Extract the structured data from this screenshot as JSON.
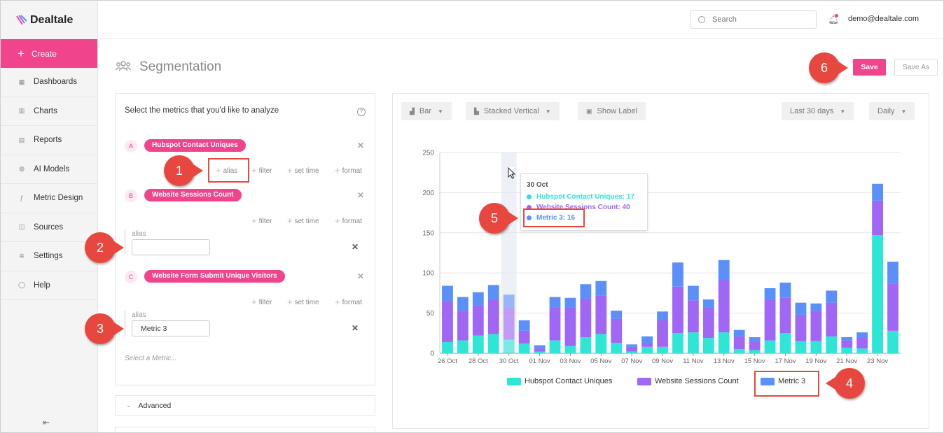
{
  "brand": "Dealtale",
  "sidebar": {
    "create_label": "Create",
    "items": [
      {
        "label": "Dashboards",
        "icon": "grid-icon"
      },
      {
        "label": "Charts",
        "icon": "bar-chart-icon"
      },
      {
        "label": "Reports",
        "icon": "document-icon"
      },
      {
        "label": "AI Models",
        "icon": "ai-icon"
      },
      {
        "label": "Metric Design",
        "icon": "function-icon"
      },
      {
        "label": "Sources",
        "icon": "database-icon"
      },
      {
        "label": "Settings",
        "icon": "gear-icon"
      },
      {
        "label": "Help",
        "icon": "help-icon"
      }
    ]
  },
  "topbar": {
    "search_placeholder": "Search",
    "user_email": "demo@dealtale.com"
  },
  "page": {
    "title": "Segmentation",
    "save": "Save",
    "save_as": "Save As"
  },
  "metrics_panel": {
    "title": "Select the metrics that you'd like to analyze",
    "metrics": [
      {
        "letter": "A",
        "name": "Hubspot Contact Uniques"
      },
      {
        "letter": "B",
        "name": "Website Sessions Count",
        "alias_label": "alias",
        "alias_value": ""
      },
      {
        "letter": "C",
        "name": "Website Form Submit Unique Visitors",
        "alias_label": "alias",
        "alias_value": "Metric 3"
      }
    ],
    "options": {
      "alias": "alias",
      "filter": "filter",
      "set_time": "set time",
      "format": "format"
    },
    "select_placeholder": "Select a Metric...",
    "advanced": "Advanced"
  },
  "chart_toolbar": {
    "chart_type": "Bar",
    "stacking": "Stacked Vertical",
    "show_label": "Show Label",
    "range": "Last 30 days",
    "granularity": "Daily"
  },
  "tooltip": {
    "date": "30 Oct",
    "rows": [
      {
        "text": "Hubspot Contact Uniques: 17",
        "color": "#2ee6d6"
      },
      {
        "text": "Website Sessions Count: 40",
        "color": "#a066f5"
      },
      {
        "text": "Metric 3: 16",
        "color": "#5b8ff9"
      }
    ]
  },
  "chart_data": {
    "type": "bar",
    "stacked": true,
    "categories": [
      "26 Oct",
      "27 Oct",
      "28 Oct",
      "29 Oct",
      "30 Oct",
      "31 Oct",
      "01 Nov",
      "02 Nov",
      "03 Nov",
      "04 Nov",
      "05 Nov",
      "06 Nov",
      "07 Nov",
      "08 Nov",
      "09 Nov",
      "10 Nov",
      "11 Nov",
      "12 Nov",
      "13 Nov",
      "14 Nov",
      "15 Nov",
      "16 Nov",
      "17 Nov",
      "18 Nov",
      "19 Nov",
      "20 Nov",
      "21 Nov",
      "22 Nov",
      "23 Nov",
      "24 Nov"
    ],
    "tick_labels": [
      "26 Oct",
      "28 Oct",
      "30 Oct",
      "01 Nov",
      "03 Nov",
      "05 Nov",
      "07 Nov",
      "09 Nov",
      "11 Nov",
      "13 Nov",
      "15 Nov",
      "17 Nov",
      "19 Nov",
      "21 Nov",
      "23 Nov"
    ],
    "series": [
      {
        "name": "Hubspot Contact Uniques",
        "color": "#2ee6d6",
        "values": [
          14,
          16,
          22,
          24,
          17,
          12,
          2,
          16,
          9,
          20,
          24,
          13,
          2,
          8,
          8,
          25,
          26,
          19,
          26,
          5,
          4,
          16,
          25,
          15,
          15,
          21,
          7,
          6,
          147,
          28
        ]
      },
      {
        "name": "Website Sessions Count",
        "color": "#a066f5",
        "values": [
          51,
          37,
          38,
          43,
          40,
          16,
          4,
          41,
          48,
          48,
          48,
          30,
          6,
          5,
          33,
          58,
          40,
          38,
          65,
          16,
          11,
          51,
          44,
          33,
          38,
          42,
          9,
          14,
          43,
          59
        ]
      },
      {
        "name": "Metric 3",
        "color": "#5b8ff9",
        "values": [
          19,
          17,
          16,
          18,
          16,
          13,
          4,
          13,
          12,
          18,
          18,
          10,
          3,
          8,
          11,
          30,
          18,
          10,
          25,
          8,
          5,
          14,
          19,
          15,
          9,
          15,
          4,
          6,
          21,
          27
        ]
      }
    ],
    "ylim": [
      0,
      250
    ],
    "yticks": [
      0,
      50,
      100,
      150,
      200,
      250
    ],
    "grid": true,
    "legend_position": "bottom"
  },
  "callouts": [
    "1",
    "2",
    "3",
    "4",
    "5",
    "6"
  ]
}
